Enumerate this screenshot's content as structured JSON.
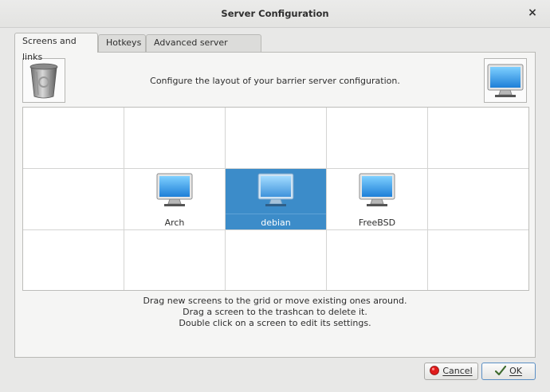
{
  "window": {
    "title": "Server Configuration",
    "close_icon": "×"
  },
  "tabs": [
    {
      "label": "Screens and links",
      "active": true
    },
    {
      "label": "Hotkeys",
      "active": false
    },
    {
      "label": "Advanced server settings",
      "active": false
    }
  ],
  "header": {
    "text": "Configure the layout of your barrier server configuration."
  },
  "grid": {
    "columns": 5,
    "rows": 3,
    "screens": [
      {
        "name": "Arch",
        "col": 1,
        "row": 1,
        "selected": false
      },
      {
        "name": "debian",
        "col": 2,
        "row": 1,
        "selected": true
      },
      {
        "name": "FreeBSD",
        "col": 3,
        "row": 1,
        "selected": false
      }
    ]
  },
  "instructions": [
    "Drag new screens to the grid or move existing ones around.",
    "Drag a screen to the trashcan to delete it.",
    "Double click on a screen to edit its settings."
  ],
  "buttons": {
    "cancel": {
      "label": "Cancel"
    },
    "ok": {
      "label": "OK"
    }
  },
  "colors": {
    "selection": "#3c8cc9",
    "accent": "#5b8fc4"
  }
}
